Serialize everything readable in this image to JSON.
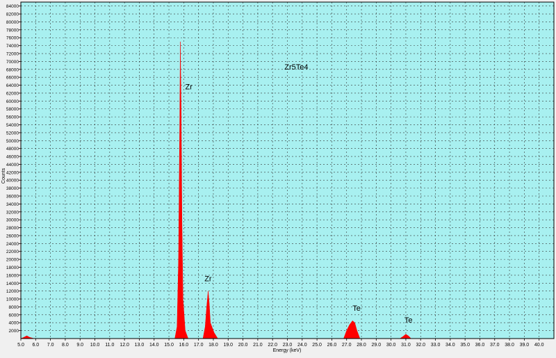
{
  "chart_data": {
    "type": "area",
    "title": "Zr5Te4",
    "xlabel": "Energy (keV)",
    "ylabel": "Counts",
    "xlim": [
      5.0,
      41.0
    ],
    "ylim": [
      0,
      85000
    ],
    "x_ticks": [
      "5.0",
      "6.0",
      "7.0",
      "8.0",
      "9.0",
      "10.0",
      "11.0",
      "12.0",
      "13.0",
      "14.0",
      "15.0",
      "16.0",
      "17.0",
      "18.0",
      "19.0",
      "20.0",
      "21.0",
      "22.0",
      "23.0",
      "24.0",
      "25.0",
      "26.0",
      "27.0",
      "28.0",
      "29.0",
      "30.0",
      "31.0",
      "32.0",
      "33.0",
      "34.0",
      "35.0",
      "36.0",
      "37.0",
      "38.0",
      "39.0",
      "40.0"
    ],
    "y_ticks": [
      "2000",
      "4000",
      "6000",
      "8000",
      "10000",
      "12000",
      "14000",
      "16000",
      "18000",
      "20000",
      "22000",
      "24000",
      "26000",
      "28000",
      "30000",
      "32000",
      "34000",
      "36000",
      "38000",
      "40000",
      "42000",
      "44000",
      "46000",
      "48000",
      "50000",
      "52000",
      "54000",
      "56000",
      "58000",
      "60000",
      "62000",
      "64000",
      "66000",
      "68000",
      "70000",
      "72000",
      "74000",
      "76000",
      "78000",
      "80000",
      "82000",
      "84000"
    ],
    "grid": true,
    "colors": {
      "plot_bg": "#a8f0f0",
      "fill": "#ff0000",
      "grid": "#333333",
      "frame": "#000000"
    },
    "series": [
      {
        "values": [
          [
            5.0,
            0
          ],
          [
            5.2,
            300
          ],
          [
            5.4,
            700
          ],
          [
            5.6,
            300
          ],
          [
            5.9,
            0
          ],
          [
            15.4,
            0
          ],
          [
            15.55,
            3000
          ],
          [
            15.65,
            20000
          ],
          [
            15.72,
            50000
          ],
          [
            15.77,
            75000
          ],
          [
            15.82,
            60000
          ],
          [
            15.88,
            30000
          ],
          [
            15.95,
            10000
          ],
          [
            16.1,
            2000
          ],
          [
            16.3,
            0
          ],
          [
            17.3,
            0
          ],
          [
            17.45,
            3000
          ],
          [
            17.55,
            8000
          ],
          [
            17.65,
            12000
          ],
          [
            17.72,
            9000
          ],
          [
            17.8,
            4000
          ],
          [
            17.9,
            3000
          ],
          [
            18.05,
            1500
          ],
          [
            18.3,
            0
          ],
          [
            26.8,
            0
          ],
          [
            27.0,
            2000
          ],
          [
            27.2,
            3500
          ],
          [
            27.4,
            4500
          ],
          [
            27.55,
            4000
          ],
          [
            27.7,
            2000
          ],
          [
            27.9,
            0
          ],
          [
            30.6,
            0
          ],
          [
            30.8,
            500
          ],
          [
            31.0,
            1100
          ],
          [
            31.2,
            600
          ],
          [
            31.35,
            0
          ],
          [
            41.0,
            0
          ]
        ]
      }
    ],
    "annotations": [
      {
        "text": "Zr",
        "x": 16.1,
        "y": 63000
      },
      {
        "text": "Zr",
        "x": 17.4,
        "y": 14500
      },
      {
        "text": "Te",
        "x": 27.4,
        "y": 7000
      },
      {
        "text": "Te",
        "x": 30.9,
        "y": 4000
      },
      {
        "text": "Zr5Te4",
        "x": 22.8,
        "y": 68000
      }
    ]
  }
}
